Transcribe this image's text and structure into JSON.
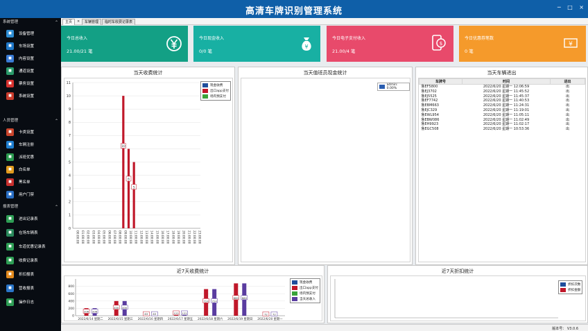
{
  "app": {
    "title": "高清车牌识别管理系统",
    "window_controls": [
      "─",
      "□",
      "×"
    ]
  },
  "sidebar": {
    "sections": [
      {
        "title": "系统管理",
        "items": [
          {
            "label": "设备管理",
            "icon": "camera-icon",
            "color": "#2f8fd5"
          },
          {
            "label": "车场设置",
            "icon": "parking-icon",
            "color": "#1f78c8"
          },
          {
            "label": "内容设置",
            "icon": "content-icon",
            "color": "#3a7bd5"
          },
          {
            "label": "通道设置",
            "icon": "channel-icon",
            "color": "#2a9a6a"
          },
          {
            "label": "票务设置",
            "icon": "ticket-icon",
            "color": "#d6322f"
          },
          {
            "label": "系统设置",
            "icon": "settings-icon",
            "color": "#c93b2c"
          }
        ]
      },
      {
        "title": "人员管理",
        "items": [
          {
            "label": "卡类设置",
            "icon": "card-type-icon",
            "color": "#c9452c"
          },
          {
            "label": "车辆注册",
            "icon": "car-register-icon",
            "color": "#1f7fd0"
          },
          {
            "label": "派班优惠",
            "icon": "discount-icon",
            "color": "#2b9a4f"
          },
          {
            "label": "白名单",
            "icon": "whitelist-icon",
            "color": "#e29b1e"
          },
          {
            "label": "黑名单",
            "icon": "blacklist-icon",
            "color": "#c8302e"
          },
          {
            "label": "用户门禁",
            "icon": "access-icon",
            "color": "#2a6fc5"
          }
        ]
      },
      {
        "title": "报表管理",
        "items": [
          {
            "label": "进出记录表",
            "icon": "record-icon",
            "color": "#2e9e55"
          },
          {
            "label": "在场车辆表",
            "icon": "onsite-icon",
            "color": "#2a8a5c"
          },
          {
            "label": "车道优惠记录表",
            "icon": "lane-discount-icon",
            "color": "#2e9e55"
          },
          {
            "label": "收费记录表",
            "icon": "fee-record-icon",
            "color": "#2e9e55"
          },
          {
            "label": "折扣报表",
            "icon": "discount-report-icon",
            "color": "#e28a1e"
          },
          {
            "label": "营收报表",
            "icon": "revenue-report-icon",
            "color": "#2a75c8"
          },
          {
            "label": "操作日志",
            "icon": "log-icon",
            "color": "#2e9e55"
          }
        ]
      }
    ]
  },
  "tabs": [
    {
      "label": "主页"
    },
    {
      "label": "×"
    },
    {
      "label": "车辆管理"
    },
    {
      "label": "临时车收费记录表"
    }
  ],
  "cards": [
    {
      "title": "今日总收入",
      "value": "21.00/21 笔",
      "color": "#13a085",
      "icon": "yen-circle-icon"
    },
    {
      "title": "今日现金收入",
      "value": "0/0 笔",
      "color": "#18b0a3",
      "icon": "money-bag-icon"
    },
    {
      "title": "今日电子支付收入",
      "value": "21.00/4 笔",
      "color": "#e84a6b",
      "icon": "mobile-pay-icon"
    },
    {
      "title": "今日优惠券笔数",
      "value": "0 笔",
      "color": "#f59a2b",
      "icon": "voucher-icon"
    }
  ],
  "panels": {
    "today_fee": "当天收费统计",
    "shift_cash": "当天值班员现金统计",
    "vehicle_io": "当天车辆进出",
    "week_fee": "近7天收费统计",
    "week_discount": "近7天折扣统计"
  },
  "shift_cash_legend": "admin: 0.00%",
  "io_table": {
    "columns": [
      "车牌号",
      "时间",
      "进出"
    ],
    "rows": [
      [
        "鲁EF5800",
        "2022/6/20 星期一 12:06:59",
        "出"
      ],
      [
        "鲁EJ3702",
        "2022/6/20 星期一 11:45:52",
        "出"
      ],
      [
        "鲁EJ5525",
        "2022/6/20 星期一 11:45:37",
        "出"
      ],
      [
        "鲁EF7742",
        "2022/6/20 星期一 11:40:53",
        "出"
      ],
      [
        "鲁EBM663",
        "2022/6/20 星期一 11:24:31",
        "出"
      ],
      [
        "鲁EJC329",
        "2022/6/20 星期一 11:19:01",
        "出"
      ],
      [
        "鲁EWL954",
        "2022/6/20 星期一 11:05:11",
        "出"
      ],
      [
        "鲁EBW086",
        "2022/6/20 星期一 11:02:49",
        "出"
      ],
      [
        "鲁EH9923",
        "2022/6/20 星期一 11:02:17",
        "出"
      ],
      [
        "鲁EGC508",
        "2022/6/20 星期一 10:53:36",
        "出"
      ]
    ]
  },
  "discount_legend": [
    "折扣次数",
    "折扣金额"
  ],
  "status": {
    "version": "版本号： V3.0.6"
  },
  "chart_data": [
    {
      "type": "bar",
      "title": "当天收费统计",
      "categories": [
        "00:00:00",
        "01:00:00",
        "02:00:00",
        "03:00:00",
        "04:00:00",
        "05:00:00",
        "06:00:00",
        "07:00:00",
        "08:00:00",
        "09:00:00",
        "10:00:00",
        "11:00:00",
        "12:00:00",
        "13:00:00",
        "14:00:00",
        "15:00:00",
        "16:00:00",
        "17:00:00",
        "18:00:00",
        "19:00:00",
        "20:00:00",
        "21:00:00",
        "22:00:00",
        "23:00:00"
      ],
      "series": [
        {
          "name": "现金收费",
          "color": "#1f4e9c",
          "values": [
            0,
            0,
            0,
            0,
            0,
            0,
            0,
            0,
            0,
            0,
            0,
            0,
            0,
            0,
            0,
            0,
            0,
            0,
            0,
            0,
            0,
            0,
            0,
            0
          ]
        },
        {
          "name": "出口app支付",
          "color": "#c0182a",
          "values": [
            0,
            0,
            0,
            0,
            0,
            0,
            0,
            0,
            0,
            10,
            6,
            5,
            0,
            0,
            0,
            0,
            0,
            0,
            0,
            0,
            0,
            0,
            0,
            0
          ]
        },
        {
          "name": "场内预支付",
          "color": "#3aa33a",
          "values": [
            0,
            0,
            0,
            0,
            0,
            0,
            0,
            0,
            0,
            0,
            0,
            0,
            0,
            0,
            0,
            0,
            0,
            0,
            0,
            0,
            0,
            0,
            0,
            0
          ]
        }
      ],
      "data_labels": {
        "9": "10",
        "10": "6",
        "11": "5"
      },
      "ylim": [
        0,
        11
      ],
      "yticks": [
        0,
        1,
        2,
        3,
        4,
        5,
        6,
        7,
        8,
        9,
        10,
        11
      ],
      "legend_position": "top-right",
      "grid": true
    },
    {
      "type": "bar",
      "title": "近7天收费统计",
      "categories": [
        "2022/6/14 星期二",
        "2022/6/15 星期三",
        "2022/6/16 星期四",
        "2022/6/17 星期五",
        "2022/6/18 星期六",
        "2022/6/19 星期日",
        "2022/6/20 星期一"
      ],
      "series": [
        {
          "name": "现金收费",
          "color": "#1f4e9c",
          "values": [
            0,
            0,
            0,
            0,
            0,
            0,
            0
          ]
        },
        {
          "name": "出口app支付",
          "color": "#c0182a",
          "values": [
            206,
            400,
            83,
            122,
            724,
            880,
            72
          ]
        },
        {
          "name": "场内预支付",
          "color": "#3aa33a",
          "values": [
            0,
            0,
            0,
            0,
            0,
            0,
            0
          ]
        },
        {
          "name": "当天总收入",
          "color": "#5a3ca0",
          "values": [
            206,
            400,
            83,
            122,
            724,
            880,
            72
          ]
        }
      ],
      "data_labels": [
        "206",
        "400",
        "83",
        "122",
        "724",
        "880",
        "72"
      ],
      "ylim": [
        0,
        1000
      ],
      "yticks": [
        0,
        200,
        400,
        600,
        800
      ],
      "legend_position": "top-right",
      "grid": true
    }
  ]
}
